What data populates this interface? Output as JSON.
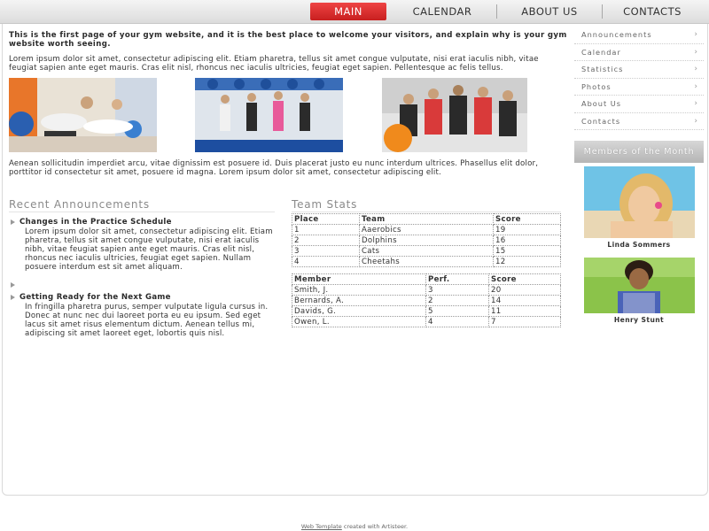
{
  "nav": {
    "items": [
      "MAIN",
      "CALENDAR",
      "ABOUT US",
      "CONTACTS"
    ],
    "active": "MAIN"
  },
  "main": {
    "intro_bold": "This is the first page of your gym website, and it is the best place to welcome your visitors, and explain why is your gym website worth seeing.",
    "intro": "Lorem ipsum dolor sit amet, consectetur adipiscing elit. Etiam pharetra, tellus sit amet congue vulputate, nisi erat iaculis nibh, vitae feugiat sapien ante eget mauris. Cras elit nisl, rhoncus nec iaculis ultricies, feugiat eget sapien. Pellentesque ac felis tellus.",
    "para2": "Aenean sollicitudin imperdiet arcu, vitae dignissim est posuere id. Duis placerat justo eu nunc interdum ultrices. Phasellus elit dolor, porttitor id consectetur sit amet, posuere id magna. Lorem ipsum dolor sit amet, consectetur adipiscing elit."
  },
  "announcements": {
    "title": "Recent Announcements",
    "items": [
      {
        "title": "Changes in the Practice Schedule",
        "body": "Lorem ipsum dolor sit amet, consectetur adipiscing elit. Etiam pharetra, tellus sit amet congue vulputate, nisi erat iaculis nibh, vitae feugiat sapien ante eget mauris. Cras elit nisl, rhoncus nec iaculis ultricies, feugiat eget sapien. Nullam posuere interdum est sit amet aliquam."
      },
      {
        "title": "Getting Ready for the Next Game",
        "body": "In fringilla pharetra purus, semper vulputate ligula cursus in. Donec at nunc nec dui laoreet porta eu eu ipsum. Sed eget lacus sit amet risus elementum dictum. Aenean tellus mi, adipiscing sit amet laoreet eget, lobortis quis nisl."
      }
    ]
  },
  "stats": {
    "title": "Team Stats",
    "teams": {
      "headers": [
        "Place",
        "Team",
        "Score"
      ],
      "rows": [
        [
          "1",
          "Aaerobics",
          "19"
        ],
        [
          "2",
          "Dolphins",
          "16"
        ],
        [
          "3",
          "Cats",
          "15"
        ],
        [
          "4",
          "Cheetahs",
          "12"
        ]
      ]
    },
    "members": {
      "headers": [
        "Member",
        "Perf.",
        "Score"
      ],
      "rows": [
        [
          "Smith, J.",
          "3",
          "20"
        ],
        [
          "Bernards, A.",
          "2",
          "14"
        ],
        [
          "Davids, G.",
          "5",
          "11"
        ],
        [
          "Owen, L.",
          "4",
          "7"
        ]
      ]
    }
  },
  "sidebar": {
    "items": [
      "Announcements",
      "Calendar",
      "Statistics",
      "Photos",
      "About Us",
      "Contacts"
    ],
    "chevron": "›",
    "members_title": "Members of the Month",
    "members": [
      {
        "name": "Linda Sommers"
      },
      {
        "name": "Henry Stunt"
      }
    ]
  },
  "footer": {
    "link": "Web Template",
    "text": " created with Artisteer."
  },
  "colors": {
    "accent": "#d92b2b",
    "section_title": "#8a8a8a"
  }
}
